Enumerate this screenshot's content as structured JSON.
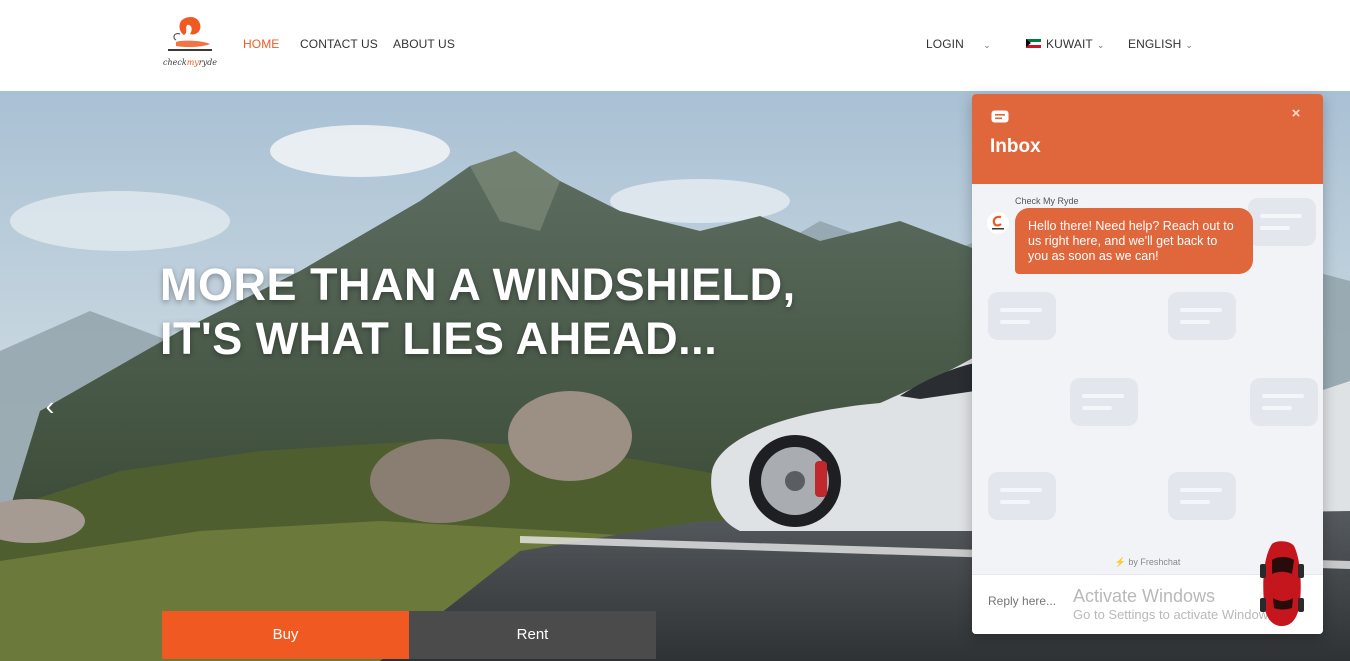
{
  "brand": {
    "logo_text_pre": "check",
    "logo_text_mid": "my",
    "logo_text_post": "ryde",
    "accent_color": "#f05a22"
  },
  "nav": {
    "home": "HOME",
    "contact": "CONTACT US",
    "about": "ABOUT US",
    "login": "LOGIN",
    "country": "KUWAIT",
    "language": "ENGLISH"
  },
  "hero": {
    "headline_line1": "MORE THAN A WINDSHIELD,",
    "headline_line2": "IT'S WHAT LIES AHEAD...",
    "prev_icon": "chevron-left-icon",
    "prev_glyph": "‹"
  },
  "tabs": {
    "buy": "Buy",
    "rent": "Rent"
  },
  "chat": {
    "title": "Inbox",
    "close_glyph": "×",
    "sender": "Check My Ryde",
    "message": "Hello there! Need help? Reach out to us right here, and we'll get back to you as soon as we can!",
    "powered_by": "by Freshchat",
    "reply_placeholder": "Reply here...",
    "header_color": "#e0663c"
  },
  "watermark": {
    "line1": "Activate Windows",
    "line2": "Go to Settings to activate Windows."
  }
}
